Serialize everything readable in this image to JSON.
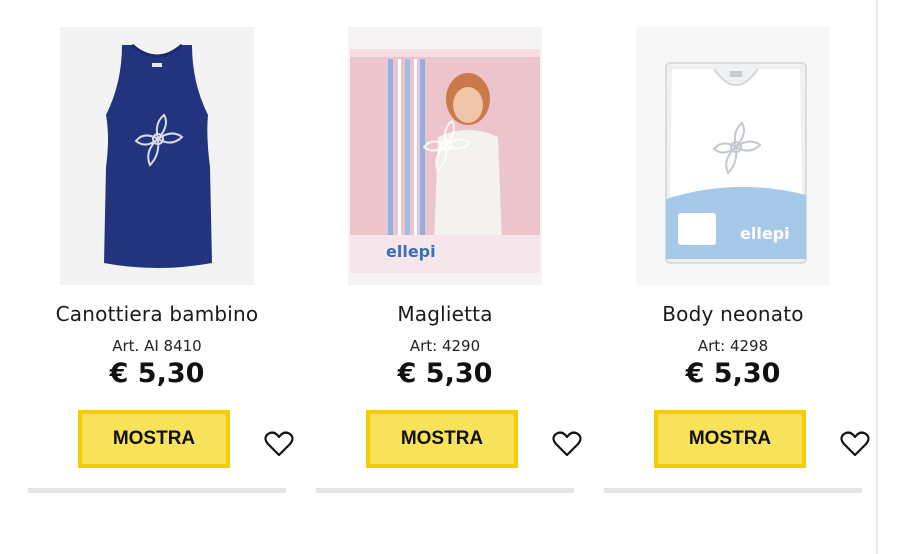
{
  "products": [
    {
      "name": "Canottiera bambino",
      "article": "Art. AI 8410",
      "price": "€ 5,30",
      "button_label": "MOSTRA",
      "image": "navy-tank-top",
      "image_color": "#22347e"
    },
    {
      "name": "Maglietta",
      "article": "Art: 4290",
      "price": "€ 5,30",
      "button_label": "MOSTRA",
      "image": "packaged-girl-tshirt",
      "package_logo": "ellepi",
      "package_color": "#e9b5c0"
    },
    {
      "name": "Body neonato",
      "article": "Art: 4298",
      "price": "€ 5,30",
      "button_label": "MOSTRA",
      "image": "packaged-baby-body",
      "package_logo": "ellepi",
      "package_color": "#a8c8ea"
    }
  ],
  "colors": {
    "button_fill": "#f7e25a",
    "button_border": "#f2cd00",
    "divider": "#e5e5e5"
  },
  "icons": [
    "heart-outline-icon"
  ]
}
